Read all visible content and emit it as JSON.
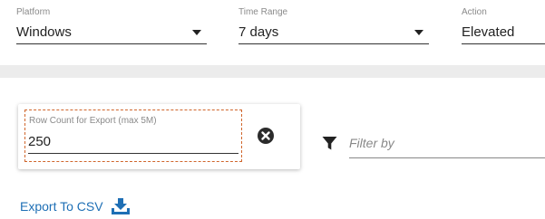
{
  "filters": [
    {
      "label": "Platform",
      "value": "Windows"
    },
    {
      "label": "Time Range",
      "value": "7 days"
    },
    {
      "label": "Action",
      "value": "Elevated"
    }
  ],
  "export_panel": {
    "row_count_label": "Row Count for Export (max 5M)",
    "row_count_value": "250",
    "clear_icon": "close-circle-icon"
  },
  "filter_by": {
    "placeholder": "Filter by",
    "icon": "funnel-icon"
  },
  "export_link": {
    "label": "Export To CSV",
    "icon": "download-icon"
  },
  "colors": {
    "accent": "#1e6fb5",
    "focus_outline": "#d0662c"
  }
}
